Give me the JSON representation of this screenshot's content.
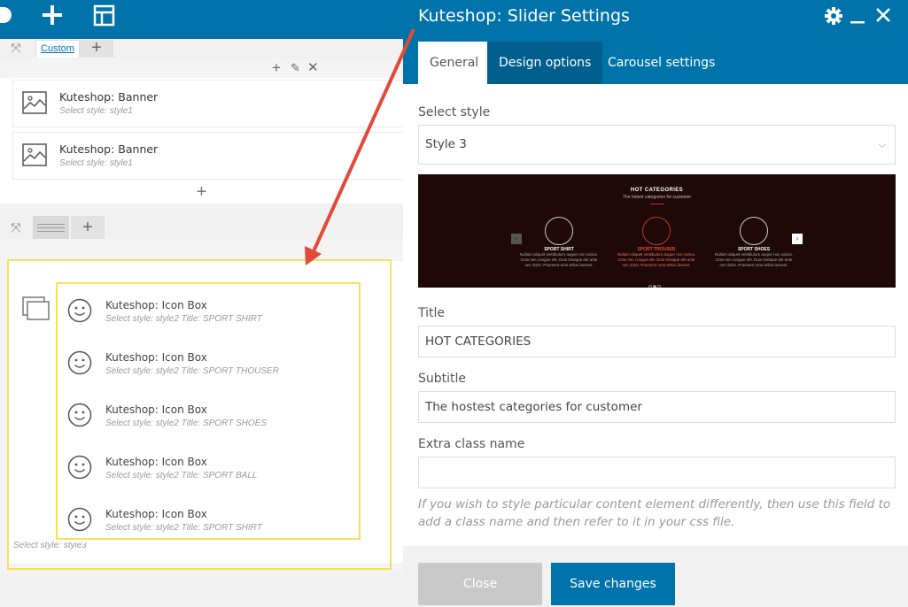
{
  "colors": {
    "brand": "#0073aa",
    "highlight": "#f7e253",
    "arrow": "#e04a3a"
  },
  "toolbar": {
    "icons": [
      "logo-icon",
      "add-icon",
      "templates-icon"
    ]
  },
  "row1": {
    "tab_label": "Custom",
    "elements": [
      {
        "name": "Kuteshop: Banner",
        "sub": "Select style: style1"
      },
      {
        "name": "Kuteshop: Banner",
        "sub": "Select style: style1"
      }
    ]
  },
  "row2": {
    "elements": [
      {
        "name": "Kuteshop: Icon Box",
        "sub": "Select style: style2  Title: SPORT SHIRT"
      },
      {
        "name": "Kuteshop: Icon Box",
        "sub": "Select style: style2  Title: SPORT THOUSER"
      },
      {
        "name": "Kuteshop: Icon Box",
        "sub": "Select style: style2  Title: SPORT SHOES"
      },
      {
        "name": "Kuteshop: Icon Box",
        "sub": "Select style: style2  Title: SPORT BALL"
      },
      {
        "name": "Kuteshop: Icon Box",
        "sub": "Select style: style2  Title: SPORT SHIRT"
      }
    ],
    "inner_style": "Select style: style3"
  },
  "modal": {
    "title": "Kuteshop: Slider Settings",
    "tabs": [
      "General",
      "Design options",
      "Carousel settings"
    ],
    "select_style_label": "Select style",
    "select_style_value": "Style 3",
    "preview": {
      "title": "HOT CATEGORIES",
      "subtitle": "The hotest categories for customer",
      "items": [
        {
          "name": "SPORT SHIRT",
          "desc": "Nullam aliquet vestibulum augue non varius. Cras nec congue elit. Duis tristique del ante nec dolor. Praesent urna tellus laoreet.",
          "highlight": false
        },
        {
          "name": "SPORT TROUSER",
          "desc": "Nullam aliquet vestibulum augue non varius. Cras nec congue elit. Duis tristique del ante nec dolor. Praesent urna tellus laoreet.",
          "highlight": true
        },
        {
          "name": "SPORT SHOES",
          "desc": "Nullam aliquet vestibulum augue non varius. Cras nec congue elit. Duis tristique del ante nec dolor. Praesent urna tellus laoreet.",
          "highlight": false
        }
      ]
    },
    "title_label": "Title",
    "title_value": "HOT CATEGORIES",
    "subtitle_label": "Subtitle",
    "subtitle_value": "The hostest categories for customer",
    "extra_label": "Extra class name",
    "extra_value": "",
    "help": "If you wish to style particular content element differently, then use this field to add a class name and then refer to it in your css file.",
    "close_label": "Close",
    "save_label": "Save changes"
  }
}
